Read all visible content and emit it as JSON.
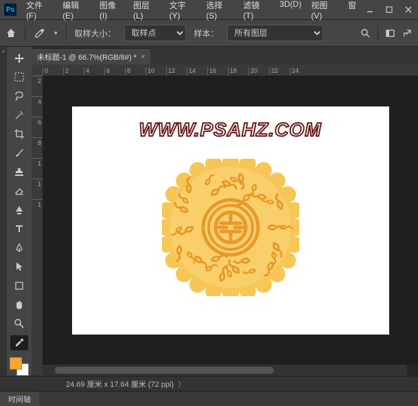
{
  "menu": {
    "file": "文件(F)",
    "edit": "编辑(E)",
    "image": "图像(I)",
    "layer": "图层(L)",
    "type": "文字(Y)",
    "select": "选择(S)",
    "filter": "滤镜(T)",
    "threed": "3D(D)",
    "view": "视图(V)",
    "window": "窗"
  },
  "options": {
    "sample_size_label": "取样大小：",
    "sample_size_value": "取样点",
    "sample_label": "样本：",
    "sample_value": "所有图层"
  },
  "tab": {
    "title": "未标题-1 @ 66.7%(RGB/8#) *"
  },
  "ruler_h": [
    "0",
    "2",
    "4",
    "6",
    "8",
    "10",
    "12",
    "14",
    "16",
    "18",
    "20",
    "22",
    "24"
  ],
  "ruler_v": [
    "2",
    "4",
    "6",
    "8",
    "1",
    "1",
    "1"
  ],
  "canvas": {
    "watermark": "WWW.PSAHZ.COM"
  },
  "status": {
    "text": "24.69 厘米 x 17.64 厘米 (72 ppi)",
    "arrow": "〉"
  },
  "timeline": {
    "label": "时间轴"
  }
}
